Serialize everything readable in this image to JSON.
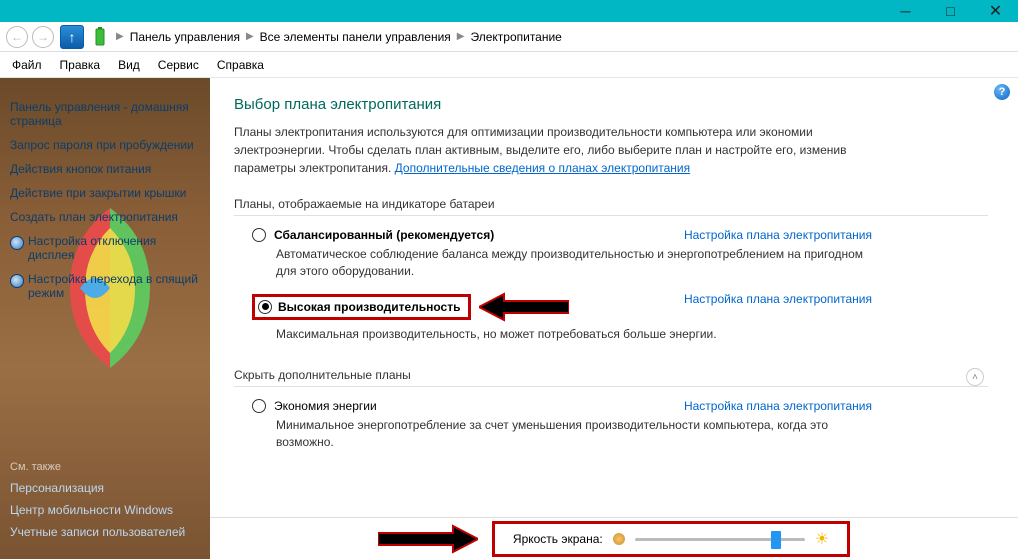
{
  "titlebar": {},
  "breadcrumb": {
    "item1": "Панель управления",
    "item2": "Все элементы панели управления",
    "item3": "Электропитание"
  },
  "menu": {
    "file": "Файл",
    "edit": "Правка",
    "view": "Вид",
    "service": "Сервис",
    "help": "Справка"
  },
  "sidebar": {
    "home": "Панель управления - домашняя страница",
    "wakepass": "Запрос пароля при пробуждении",
    "powerbtn": "Действия кнопок питания",
    "lid": "Действие при закрытии крышки",
    "createplan": "Создать план электропитания",
    "display": "Настройка отключения дисплея",
    "sleep": "Настройка перехода в спящий режим",
    "see_also": "См. также",
    "personalization": "Персонализация",
    "mobility": "Центр мобильности Windows",
    "accounts": "Учетные записи пользователей"
  },
  "main": {
    "title": "Выбор плана электропитания",
    "intro1": "Планы электропитания используются для оптимизации производительности компьютера или экономии электроэнергии. Чтобы сделать план активным, выделите его, либо выберите план и настройте его, изменив параметры электропитания. ",
    "intro_link": "Дополнительные сведения о планах электропитания",
    "section1": "Планы, отображаемые на индикаторе батареи",
    "section2": "Скрыть дополнительные планы",
    "settings_link": "Настройка плана электропитания",
    "plans": {
      "balanced": {
        "name": "Сбалансированный (рекомендуется)",
        "desc": "Автоматическое соблюдение баланса между производительностью и энергопотреблением на пригодном для этого оборудовании."
      },
      "high": {
        "name": "Высокая производительность",
        "desc": "Максимальная производительность, но может потребоваться больше энергии."
      },
      "eco": {
        "name": "Экономия энергии",
        "desc": "Минимальное энергопотребление за счет уменьшения производительности компьютера, когда это возможно."
      }
    },
    "brightness_label": "Яркость экрана:",
    "brightness_percent": 85
  }
}
